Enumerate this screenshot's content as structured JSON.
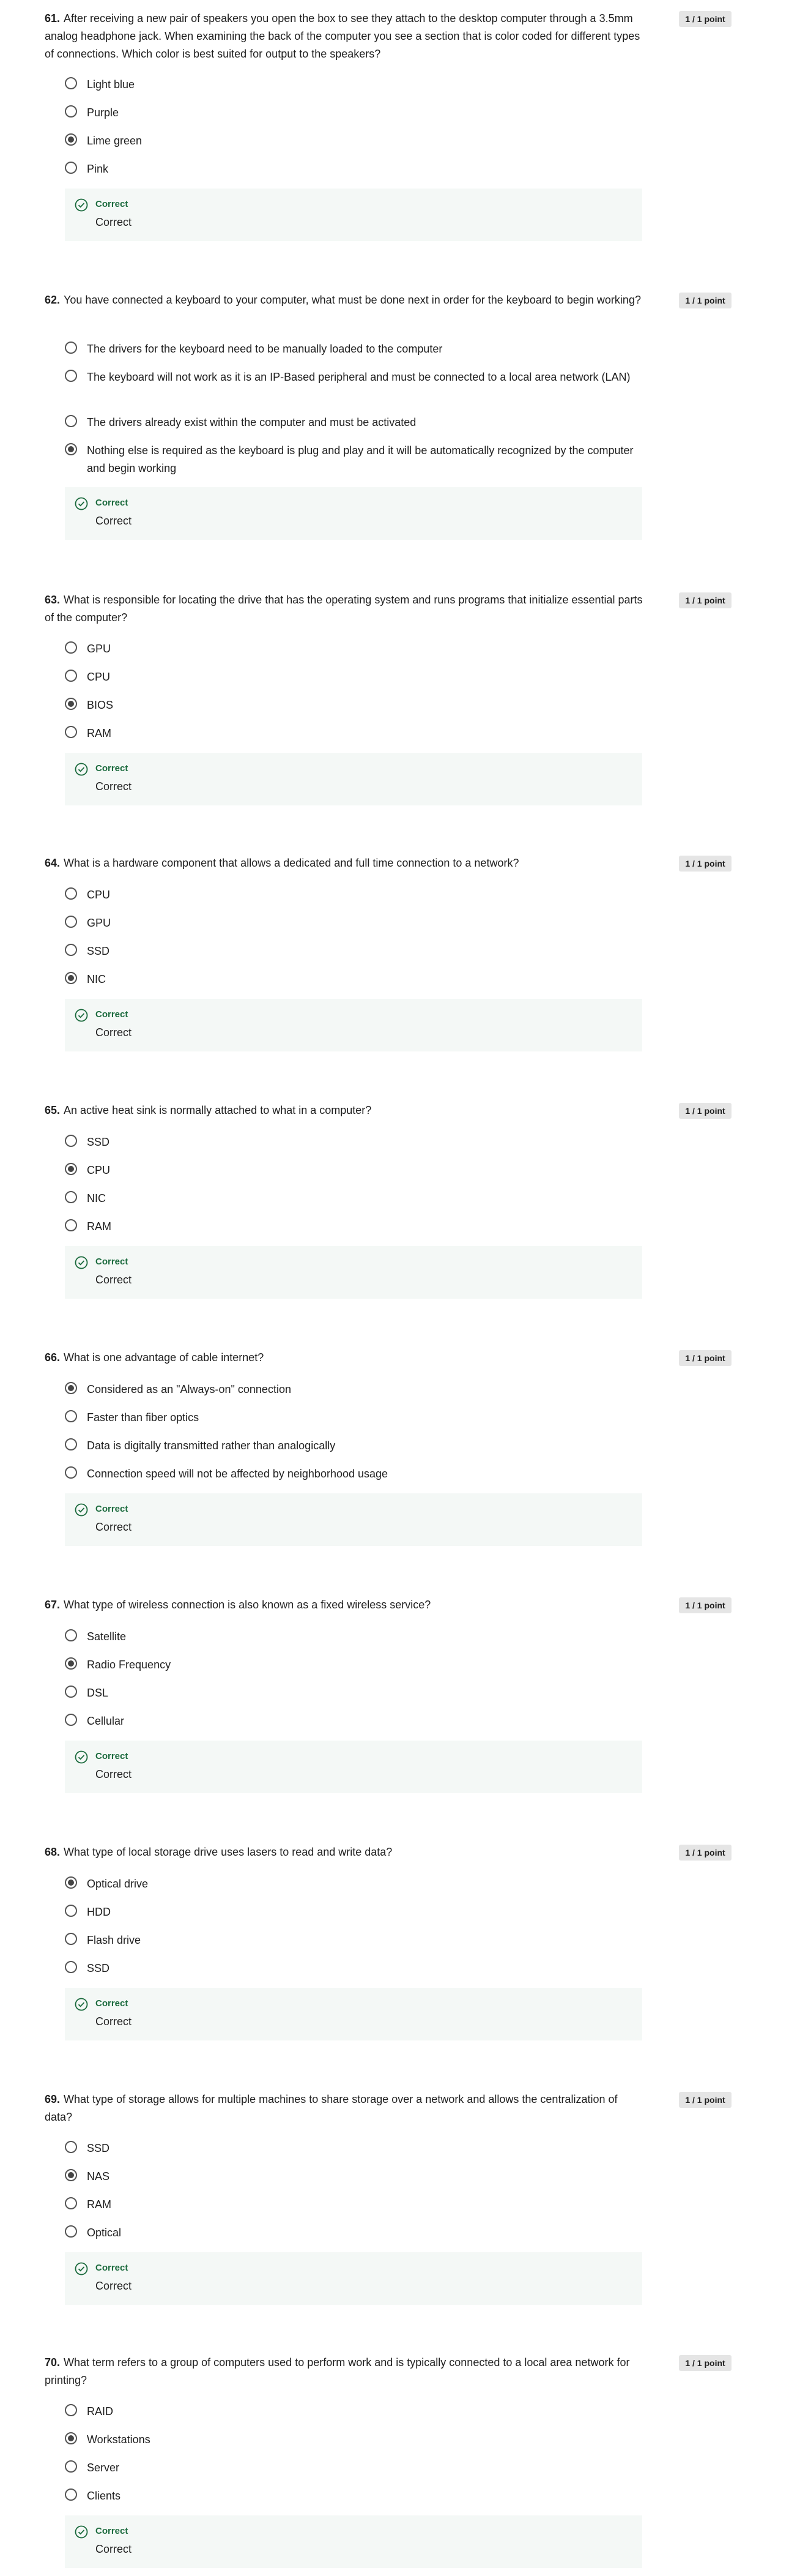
{
  "questions": [
    {
      "number": "61.",
      "text": "After receiving a new pair of speakers you open the box to see they attach to the desktop computer through a 3.5mm analog headphone jack. When examining the back of the computer you see a section that is color coded for different types of connections. Which color is best suited for output to the speakers?",
      "points": "1 / 1 point",
      "options": [
        "Light blue",
        "Purple",
        "Lime green",
        "Pink"
      ],
      "selected": 2,
      "feedback_title": "Correct",
      "feedback_text": "Correct"
    },
    {
      "number": "62.",
      "text": "You have connected a keyboard to your computer, what must be done next in order for the keyboard to begin working?",
      "points": "1 / 1 point",
      "options": [
        "The drivers for the keyboard need to be manually loaded to the computer",
        "The keyboard will not work as it is an IP-Based peripheral and must be connected to a local area network (LAN)",
        "The drivers already exist within the computer and must be activated",
        "Nothing else is required as the keyboard is plug and play and it will be automatically recognized by the computer and begin working"
      ],
      "selected": 3,
      "feedback_title": "Correct",
      "feedback_text": "Correct"
    },
    {
      "number": "63.",
      "text": "What is responsible for locating the drive that has the operating system and runs programs that initialize essential parts of the computer?",
      "points": "1 / 1 point",
      "options": [
        "GPU",
        "CPU",
        "BIOS",
        "RAM"
      ],
      "selected": 2,
      "feedback_title": "Correct",
      "feedback_text": "Correct"
    },
    {
      "number": "64.",
      "text": "What is a hardware component that allows a dedicated and full time connection to a network?",
      "points": "1 / 1 point",
      "options": [
        "CPU",
        "GPU",
        "SSD",
        "NIC"
      ],
      "selected": 3,
      "feedback_title": "Correct",
      "feedback_text": "Correct"
    },
    {
      "number": "65.",
      "text": "An active heat sink is normally attached to what in a computer?",
      "points": "1 / 1 point",
      "options": [
        "SSD",
        "CPU",
        "NIC",
        "RAM"
      ],
      "selected": 1,
      "feedback_title": "Correct",
      "feedback_text": "Correct"
    },
    {
      "number": "66.",
      "text": "What is one advantage of cable internet?",
      "points": "1 / 1 point",
      "options": [
        "Considered as an \"Always-on\" connection",
        "Faster than fiber optics",
        "Data is digitally transmitted rather than analogically",
        "Connection speed will not be affected by neighborhood usage"
      ],
      "selected": 0,
      "feedback_title": "Correct",
      "feedback_text": "Correct"
    },
    {
      "number": "67.",
      "text": "What type of wireless connection is also known as a fixed wireless service?",
      "points": "1 / 1 point",
      "options": [
        "Satellite",
        "Radio Frequency",
        "DSL",
        "Cellular"
      ],
      "selected": 1,
      "feedback_title": "Correct",
      "feedback_text": "Correct"
    },
    {
      "number": "68.",
      "text": "What type of local storage drive uses lasers to read and write data?",
      "points": "1 / 1 point",
      "options": [
        "Optical drive",
        "HDD",
        "Flash drive",
        "SSD"
      ],
      "selected": 0,
      "feedback_title": "Correct",
      "feedback_text": "Correct"
    },
    {
      "number": "69.",
      "text": "What type of storage allows for multiple machines to share storage over a network and allows the centralization of data?",
      "points": "1 / 1 point",
      "options": [
        "SSD",
        "NAS",
        "RAM",
        "Optical"
      ],
      "selected": 1,
      "feedback_title": "Correct",
      "feedback_text": "Correct"
    },
    {
      "number": "70.",
      "text": "What term refers to a group of computers used to perform work and is typically connected to a local area network for printing?",
      "points": "1 / 1 point",
      "options": [
        "RAID",
        "Workstations",
        "Server",
        "Clients"
      ],
      "selected": 1,
      "feedback_title": "Correct",
      "feedback_text": "Correct"
    }
  ],
  "colors": {
    "correct_text": "#1c6b3e",
    "feedback_bg": "#f4f8f6",
    "points_badge_bg": "#e5e5e5"
  },
  "icons": {
    "feedback": "check-circle-icon",
    "option": "radio-button-icon"
  }
}
